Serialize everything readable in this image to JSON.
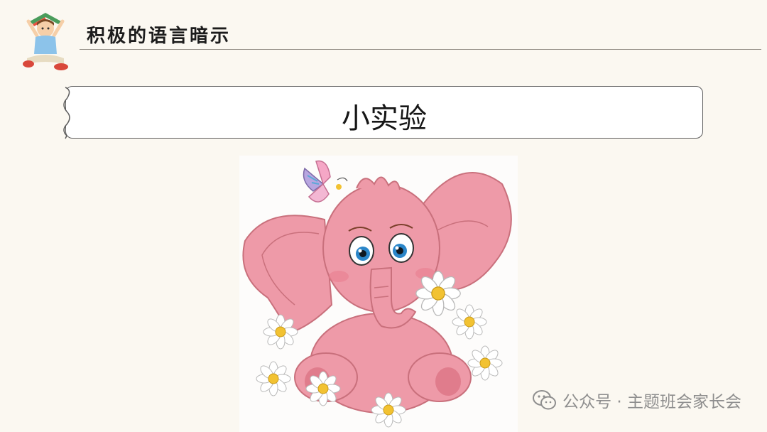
{
  "header": {
    "title": "积极的语言暗示"
  },
  "banner": {
    "title": "小实验"
  },
  "illustration": {
    "subject": "pink-elephant-with-daisies-and-butterfly"
  },
  "watermark": {
    "text": "公众号 · 主题班会家长会"
  },
  "colors": {
    "background": "#fbf8f1",
    "elephant": "#ee9aa8",
    "elephant_shade": "#d9737f",
    "daisy_center": "#f2c232",
    "rule": "#8f8a82"
  },
  "icons": [
    "reading-boy-icon",
    "wechat-icon"
  ]
}
